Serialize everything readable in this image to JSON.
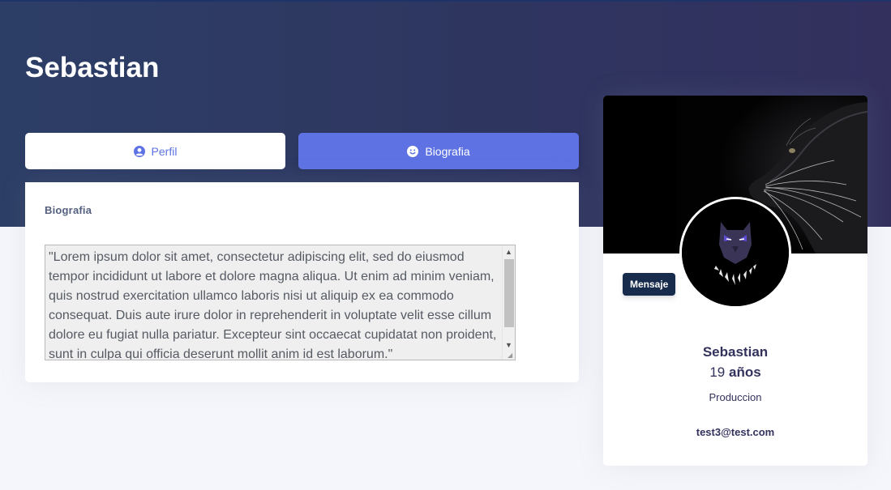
{
  "header": {
    "title": "Sebastian"
  },
  "tabs": [
    {
      "label": "Perfil",
      "icon": "user-circle-icon"
    },
    {
      "label": "Biografia",
      "icon": "smile-icon"
    }
  ],
  "biography": {
    "heading": "Biografia",
    "text": "\"Lorem ipsum dolor sit amet, consectetur adipiscing elit, sed do eiusmod tempor incididunt ut labore et dolore magna aliqua. Ut enim ad minim veniam, quis nostrud exercitation ullamco laboris nisi ut aliquip ex ea commodo consequat. Duis aute irure dolor in reprehenderit in voluptate velit esse cillum dolore eu fugiat nulla pariatur. Excepteur sint occaecat cupidatat non proident, sunt in culpa qui officia deserunt mollit anim id est laborum.\""
  },
  "profile": {
    "message_button": "Mensaje",
    "name": "Sebastian",
    "age_number": "19",
    "age_unit": "años",
    "department": "Produccion",
    "email": "test3@test.com",
    "cover_image": "black-panther-cover",
    "avatar_image": "black-panther-mask-avatar"
  },
  "colors": {
    "accent": "#5e72e4",
    "header_bg": "#2d3e66",
    "dark_button": "#172b4d",
    "text_dark": "#32325d"
  }
}
